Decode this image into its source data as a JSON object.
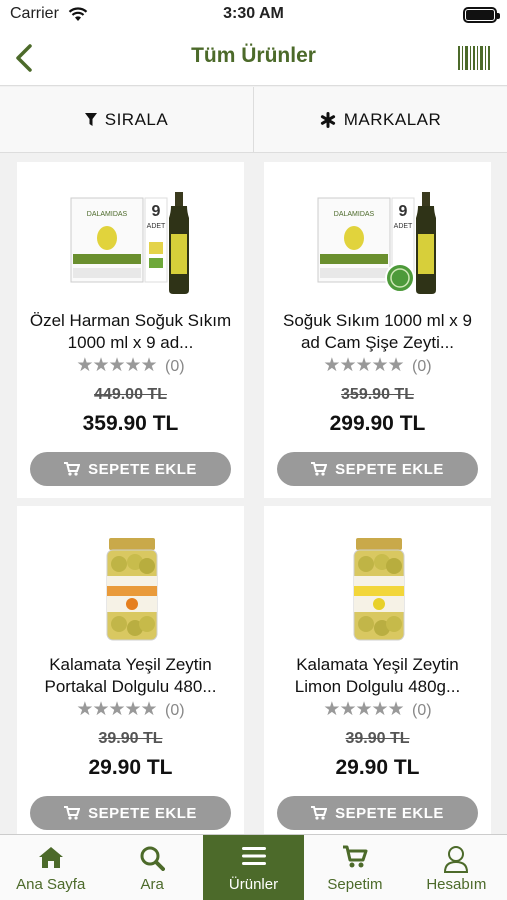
{
  "status": {
    "carrier": "Carrier",
    "time": "3:30 AM"
  },
  "header": {
    "title": "Tüm Ürünler"
  },
  "filters": {
    "sort_label": "SIRALA",
    "brands_label": "MARKALAR"
  },
  "products": [
    {
      "name": "Özel Harman Soğuk Sıkım 1000 ml x 9 ad...",
      "rating": 5,
      "review_count": "(0)",
      "old_price": "449.00 TL",
      "price": "359.90 TL",
      "button_label": "SEPETE EKLE",
      "image": "olive-oil-box-9-pack",
      "box_brand": "DALAMIDAS",
      "pack_text_1": "9",
      "pack_text_2": "ADET"
    },
    {
      "name": "Soğuk Sıkım 1000 ml x 9 ad Cam Şişe Zeyti...",
      "rating": 5,
      "review_count": "(0)",
      "old_price": "359.90 TL",
      "price": "299.90 TL",
      "button_label": "SEPETE EKLE",
      "image": "olive-oil-box-9-pack-glass",
      "box_brand": "DALAMIDAS",
      "pack_text_1": "9",
      "pack_text_2": "ADET"
    },
    {
      "name": "Kalamata Yeşil Zeytin Portakal Dolgulu 480...",
      "rating": 5,
      "review_count": "(0)",
      "old_price": "39.90 TL",
      "price": "29.90 TL",
      "button_label": "SEPETE EKLE",
      "image": "olive-jar-orange"
    },
    {
      "name": "Kalamata Yeşil Zeytin Limon Dolgulu 480g...",
      "rating": 5,
      "review_count": "(0)",
      "old_price": "39.90 TL",
      "price": "29.90 TL",
      "button_label": "SEPETE EKLE",
      "image": "olive-jar-lemon"
    }
  ],
  "tabs": [
    {
      "label": "Ana Sayfa",
      "icon": "home-icon",
      "active": false
    },
    {
      "label": "Ara",
      "icon": "search-icon",
      "active": false
    },
    {
      "label": "Ürünler",
      "icon": "menu-icon",
      "active": true
    },
    {
      "label": "Sepetim",
      "icon": "cart-icon",
      "active": false
    },
    {
      "label": "Hesabım",
      "icon": "user-icon",
      "active": false
    }
  ],
  "colors": {
    "brand_green": "#4c6a2a",
    "button_gray": "#9a9a9a",
    "background": "#f1f1f1"
  }
}
